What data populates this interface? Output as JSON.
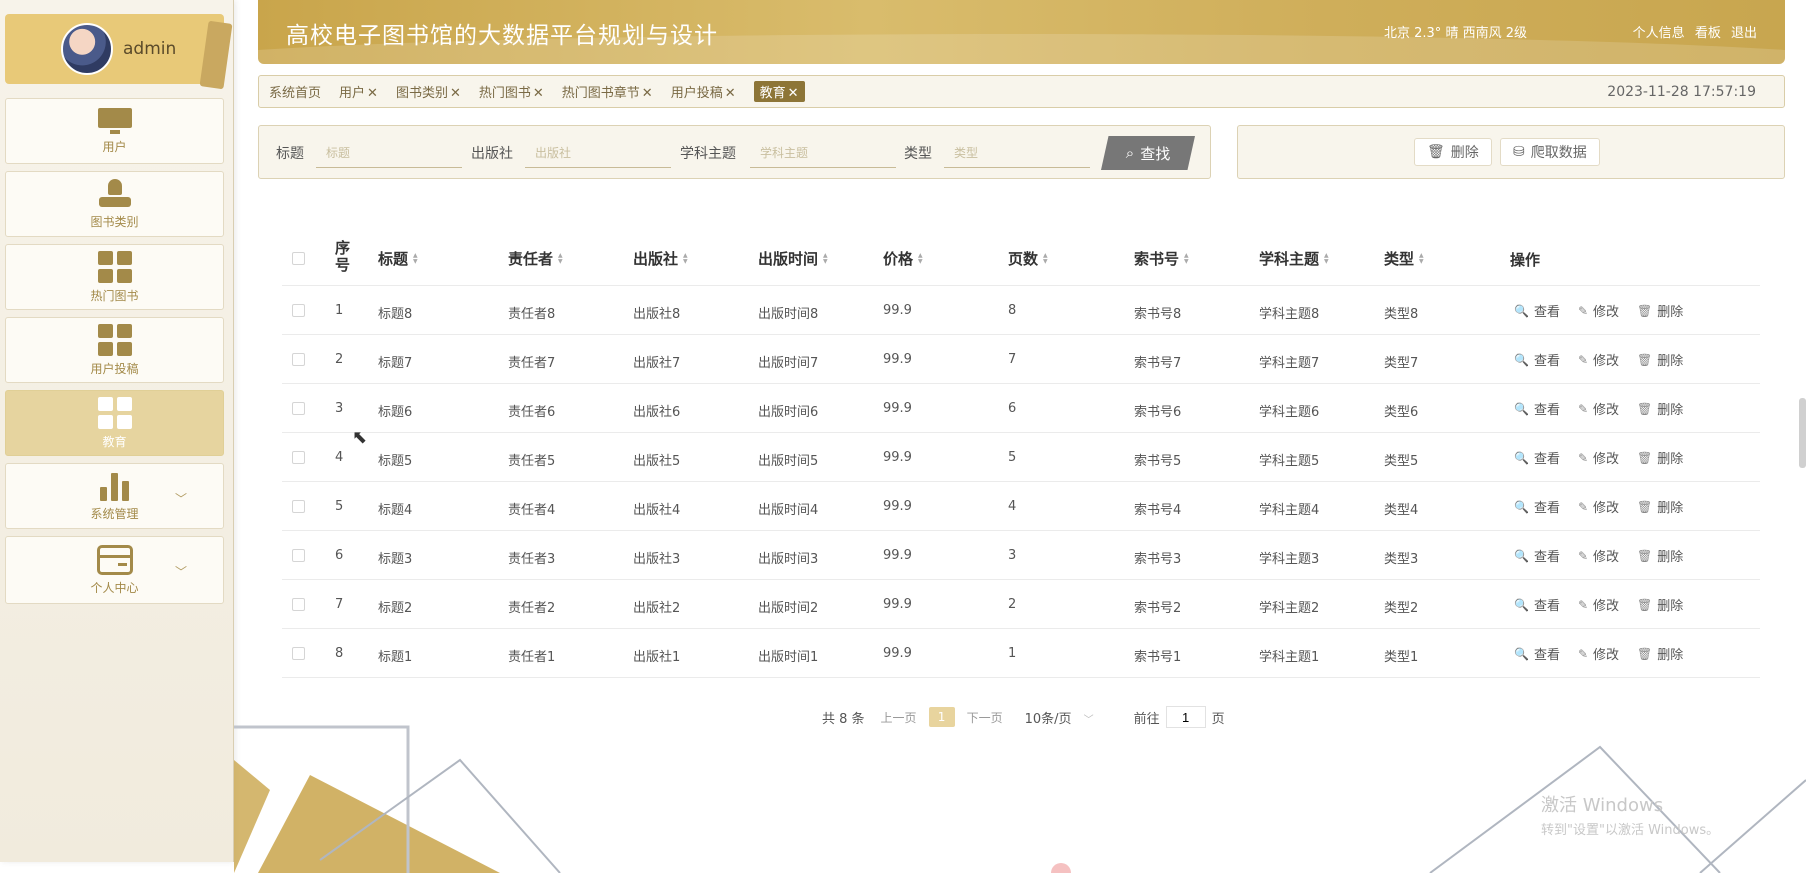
{
  "app": {
    "title": "高校电子图书馆的大数据平台规划与设计"
  },
  "header": {
    "weather": "北京  2.3°  晴  西南风  2级",
    "links": [
      "个人信息",
      "看板",
      "退出"
    ]
  },
  "user": {
    "name": "admin"
  },
  "sidebar": {
    "items": [
      {
        "label": "用户",
        "icon": "monitor-icon"
      },
      {
        "label": "图书类别",
        "icon": "stamp-icon"
      },
      {
        "label": "热门图书",
        "icon": "grid-icon"
      },
      {
        "label": "用户投稿",
        "icon": "grid-icon"
      },
      {
        "label": "教育",
        "icon": "grid-icon",
        "active": true
      },
      {
        "label": "系统管理",
        "icon": "bar-chart-icon"
      },
      {
        "label": "个人中心",
        "icon": "card-icon"
      }
    ]
  },
  "tabs": {
    "items": [
      {
        "label": "系统首页"
      },
      {
        "label": "用户"
      },
      {
        "label": "图书类别"
      },
      {
        "label": "热门图书"
      },
      {
        "label": "热门图书章节"
      },
      {
        "label": "用户投稿"
      },
      {
        "label": "教育",
        "active": true
      }
    ],
    "close_glyph": "✕",
    "datetime": "2023-11-28 17:57:19"
  },
  "search": {
    "title_label": "标题",
    "title_placeholder": "标题",
    "publisher_label": "出版社",
    "publisher_placeholder": "出版社",
    "subject_label": "学科主题",
    "subject_placeholder": "学科主题",
    "type_label": "类型",
    "type_placeholder": "类型",
    "button": "查找"
  },
  "actions": {
    "delete": "删除",
    "crawl": "爬取数据"
  },
  "table": {
    "headers": {
      "index": "序号",
      "title": "标题",
      "author": "责任者",
      "publisher": "出版社",
      "pubdate": "出版时间",
      "price": "价格",
      "pages": "页数",
      "callno": "索书号",
      "subject": "学科主题",
      "type": "类型",
      "ops": "操作"
    },
    "op_labels": {
      "view": "查看",
      "edit": "修改",
      "delete": "删除"
    },
    "rows": [
      {
        "index": "1",
        "title": "标题8",
        "author": "责任者8",
        "publisher": "出版社8",
        "pubdate": "出版时间8",
        "price": "99.9",
        "pages": "8",
        "callno": "索书号8",
        "subject": "学科主题8",
        "type": "类型8"
      },
      {
        "index": "2",
        "title": "标题7",
        "author": "责任者7",
        "publisher": "出版社7",
        "pubdate": "出版时间7",
        "price": "99.9",
        "pages": "7",
        "callno": "索书号7",
        "subject": "学科主题7",
        "type": "类型7"
      },
      {
        "index": "3",
        "title": "标题6",
        "author": "责任者6",
        "publisher": "出版社6",
        "pubdate": "出版时间6",
        "price": "99.9",
        "pages": "6",
        "callno": "索书号6",
        "subject": "学科主题6",
        "type": "类型6"
      },
      {
        "index": "4",
        "title": "标题5",
        "author": "责任者5",
        "publisher": "出版社5",
        "pubdate": "出版时间5",
        "price": "99.9",
        "pages": "5",
        "callno": "索书号5",
        "subject": "学科主题5",
        "type": "类型5"
      },
      {
        "index": "5",
        "title": "标题4",
        "author": "责任者4",
        "publisher": "出版社4",
        "pubdate": "出版时间4",
        "price": "99.9",
        "pages": "4",
        "callno": "索书号4",
        "subject": "学科主题4",
        "type": "类型4"
      },
      {
        "index": "6",
        "title": "标题3",
        "author": "责任者3",
        "publisher": "出版社3",
        "pubdate": "出版时间3",
        "price": "99.9",
        "pages": "3",
        "callno": "索书号3",
        "subject": "学科主题3",
        "type": "类型3"
      },
      {
        "index": "7",
        "title": "标题2",
        "author": "责任者2",
        "publisher": "出版社2",
        "pubdate": "出版时间2",
        "price": "99.9",
        "pages": "2",
        "callno": "索书号2",
        "subject": "学科主题2",
        "type": "类型2"
      },
      {
        "index": "8",
        "title": "标题1",
        "author": "责任者1",
        "publisher": "出版社1",
        "pubdate": "出版时间1",
        "price": "99.9",
        "pages": "1",
        "callno": "索书号1",
        "subject": "学科主题1",
        "type": "类型1"
      }
    ]
  },
  "pagination": {
    "total": "共 8 条",
    "prev": "上一页",
    "current": "1",
    "next": "下一页",
    "page_size": "10条/页",
    "goto_prefix": "前往",
    "goto_value": "1",
    "goto_suffix": "页"
  },
  "watermark": {
    "line1": "激活 Windows",
    "line2": "转到\"设置\"以激活 Windows。"
  },
  "colors": {
    "accent": "#c9a54b",
    "active_nav": "#e6d49f",
    "tab_active": "#8d7537",
    "icon": "#a38a49"
  }
}
